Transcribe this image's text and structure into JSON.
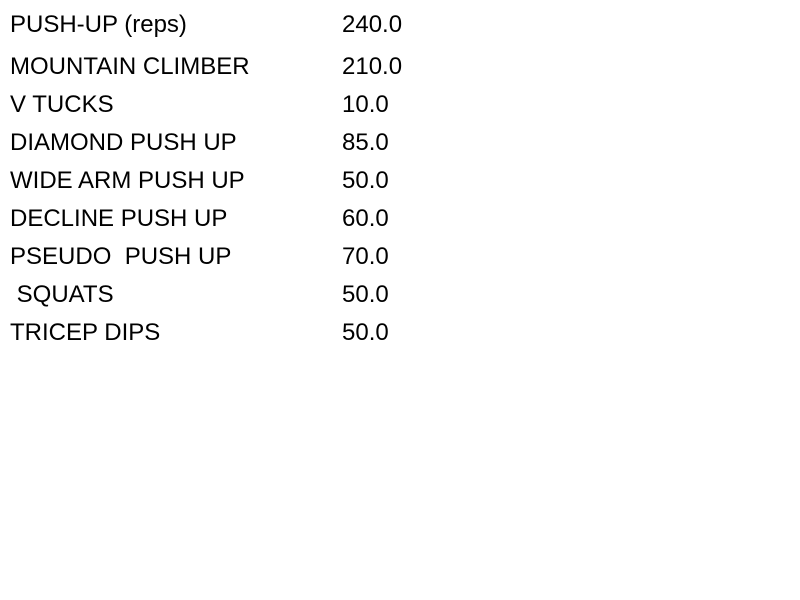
{
  "exercises": [
    {
      "name": "PUSH-UP (reps)",
      "value": "240.0"
    },
    {
      "name": "MOUNTAIN CLIMBER",
      "value": "210.0"
    },
    {
      "name": "V TUCKS",
      "value": "10.0"
    },
    {
      "name": "DIAMOND PUSH UP",
      "value": "85.0"
    },
    {
      "name": "WIDE ARM PUSH UP",
      "value": "50.0"
    },
    {
      "name": "DECLINE PUSH UP",
      "value": "60.0"
    },
    {
      "name": "PSEUDO  PUSH UP",
      "value": "70.0"
    },
    {
      "name": " SQUATS",
      "value": "50.0"
    },
    {
      "name": "TRICEP DIPS",
      "value": "50.0"
    }
  ]
}
